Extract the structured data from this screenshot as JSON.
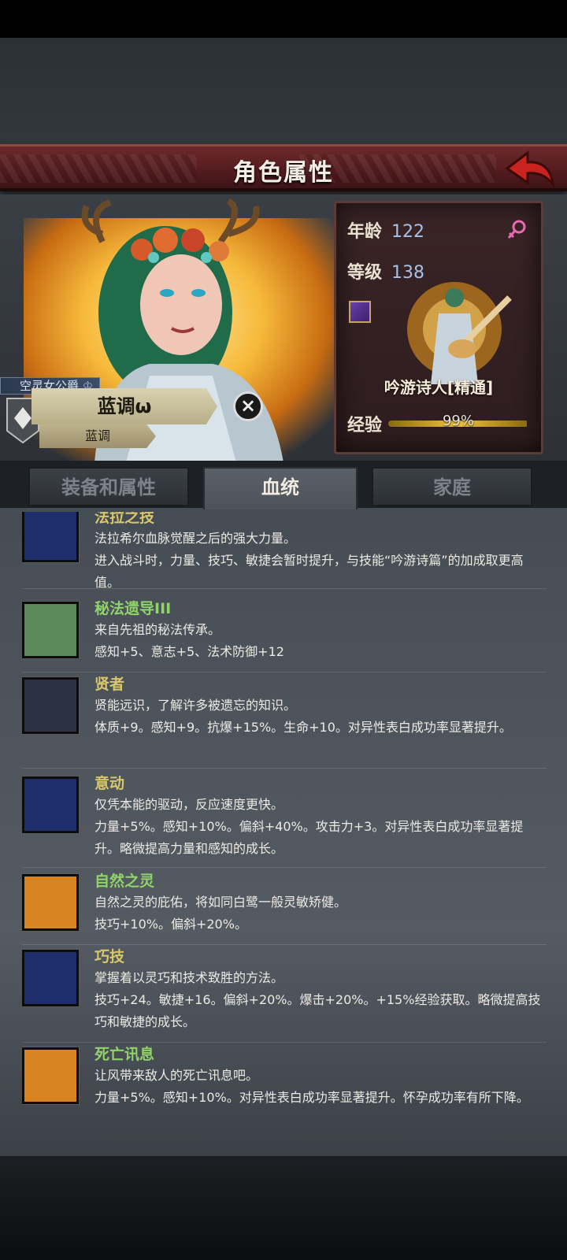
{
  "header": {
    "title": "角色属性",
    "back_icon": "back-arrow-icon"
  },
  "character": {
    "title_tag": "空灵女公爵",
    "name": "蓝调ω",
    "nickname": "蓝调",
    "age_label": "年龄",
    "age": "122",
    "level_label": "等级",
    "level": "138",
    "class_name": "吟游诗人[精通]",
    "xp_label": "经验",
    "xp_text": "99%",
    "xp_fraction": 0.99,
    "gender_icon": "female-icon"
  },
  "tabs": [
    {
      "label": "装备和属性",
      "active": false
    },
    {
      "label": "血统",
      "active": true
    },
    {
      "label": "家庭",
      "active": false
    }
  ],
  "traits": [
    {
      "name": "法拉之技",
      "icon": "golden-tree-icon",
      "lines": [
        "法拉希尔血脉觉醒之后的强大力量。",
        "进入战斗时，力量、技巧、敏捷会暂时提升，与技能“吟游诗篇”的加成取更高值。"
      ]
    },
    {
      "name": "秘法遗导III",
      "icon": "leaf-branch-icon",
      "lines": [
        "来自先祖的秘法传承。",
        "感知+5、意志+5、法术防御+12"
      ]
    },
    {
      "name": "贤者",
      "icon": "flexed-arm-icon",
      "lines": [
        "贤能远识，了解许多被遗忘的知识。",
        "体质+9。感知+9。抗爆+15%。生命+10。对异性表白成功率显著提升。"
      ]
    },
    {
      "name": "意动",
      "icon": "golden-tree-icon",
      "lines": [
        "仅凭本能的驱动，反应速度更快。",
        "力量+5%。感知+10%。偏斜+40%。攻击力+3。对异性表白成功率显著提升。略微提高力量和感知的成长。"
      ]
    },
    {
      "name": "自然之灵",
      "icon": "smiley-face-icon",
      "lines": [
        "自然之灵的庇佑，将如同白鹭一般灵敏矫健。",
        "技巧+10%。偏斜+20%。"
      ]
    },
    {
      "name": "巧技",
      "icon": "golden-tree-icon",
      "lines": [
        "掌握着以灵巧和技术致胜的方法。",
        "技巧+24。敏捷+16。偏斜+20%。爆击+20%。+15%经验获取。略微提高技巧和敏捷的成长。"
      ]
    },
    {
      "name": "死亡讯息",
      "icon": "smiley-face-icon",
      "lines": [
        "让风带来敌人的死亡讯息吧。",
        "力量+5%。感知+10%。对异性表白成功率显著提升。怀孕成功率有所下降。"
      ]
    }
  ]
}
